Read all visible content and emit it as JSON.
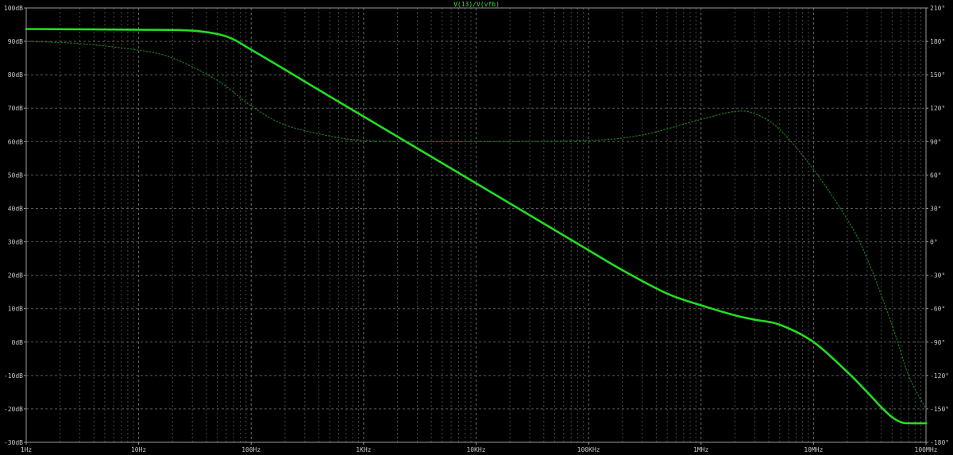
{
  "chart_data": {
    "type": "line",
    "title": "V(13)/V(vfb)",
    "xlabel": "",
    "ylabel": "",
    "x_scale": "log",
    "xlim": [
      1,
      100000000
    ],
    "ylim_left": [
      -30,
      100
    ],
    "ylim_right": [
      -180,
      210
    ],
    "grid": true,
    "x_ticks": [
      {
        "value": 1,
        "label": "1Hz"
      },
      {
        "value": 10,
        "label": "10Hz"
      },
      {
        "value": 100,
        "label": "100Hz"
      },
      {
        "value": 1000,
        "label": "1KHz"
      },
      {
        "value": 10000,
        "label": "10KHz"
      },
      {
        "value": 100000,
        "label": "100KHz"
      },
      {
        "value": 1000000,
        "label": "1MHz"
      },
      {
        "value": 10000000,
        "label": "10MHz"
      },
      {
        "value": 100000000,
        "label": "100MHz"
      }
    ],
    "y_ticks_left": [
      {
        "value": 100,
        "label": "100dB"
      },
      {
        "value": 90,
        "label": "90dB"
      },
      {
        "value": 80,
        "label": "80dB"
      },
      {
        "value": 70,
        "label": "70dB"
      },
      {
        "value": 60,
        "label": "60dB"
      },
      {
        "value": 50,
        "label": "50dB"
      },
      {
        "value": 40,
        "label": "40dB"
      },
      {
        "value": 30,
        "label": "30dB"
      },
      {
        "value": 20,
        "label": "20dB"
      },
      {
        "value": 10,
        "label": "10dB"
      },
      {
        "value": 0,
        "label": "0dB"
      },
      {
        "value": -10,
        "label": "-10dB"
      },
      {
        "value": -20,
        "label": "-20dB"
      },
      {
        "value": -30,
        "label": "-30dB"
      }
    ],
    "y_ticks_right": [
      {
        "value": 210,
        "label": "210°"
      },
      {
        "value": 180,
        "label": "180°"
      },
      {
        "value": 150,
        "label": "150°"
      },
      {
        "value": 120,
        "label": "120°"
      },
      {
        "value": 90,
        "label": "90°"
      },
      {
        "value": 60,
        "label": "60°"
      },
      {
        "value": 30,
        "label": "30°"
      },
      {
        "value": 0,
        "label": "0°"
      },
      {
        "value": -30,
        "label": "-30°"
      },
      {
        "value": -60,
        "label": "-60°"
      },
      {
        "value": -90,
        "label": "-90°"
      },
      {
        "value": -120,
        "label": "-120°"
      },
      {
        "value": -150,
        "label": "-150°"
      },
      {
        "value": -180,
        "label": "-180°"
      }
    ],
    "series": [
      {
        "axis": "left",
        "style": "solid",
        "color": "#22dd22",
        "x": [
          1,
          10,
          30,
          60,
          100,
          200,
          500,
          1000,
          10000,
          100000,
          200000,
          500000,
          1000000,
          2000000,
          3000000,
          5000000,
          10000000,
          20000000,
          30000000,
          40000000,
          50000000,
          60000000,
          70000000,
          100000000
        ],
        "y": [
          93.7,
          93.5,
          93.2,
          91.5,
          87.5,
          81.5,
          73.5,
          67.5,
          47.5,
          27.5,
          21.5,
          14.5,
          11,
          8,
          6.7,
          5.2,
          0,
          -9,
          -15,
          -19.5,
          -22.5,
          -24,
          -24.3,
          -24.3
        ]
      },
      {
        "axis": "right",
        "style": "dotted",
        "color": "#1e7a1e",
        "x": [
          1,
          3,
          10,
          20,
          50,
          100,
          200,
          500,
          1000,
          3000,
          10000,
          100000,
          300000,
          1000000,
          2000000,
          3000000,
          5000000,
          10000000,
          20000000,
          30000000,
          50000000,
          70000000,
          100000000
        ],
        "y": [
          180,
          178,
          172,
          165,
          145,
          122,
          105,
          95,
          91,
          90,
          90,
          91,
          96,
          110,
          117,
          115,
          101,
          65,
          20,
          -15,
          -75,
          -120,
          -150
        ]
      }
    ]
  }
}
